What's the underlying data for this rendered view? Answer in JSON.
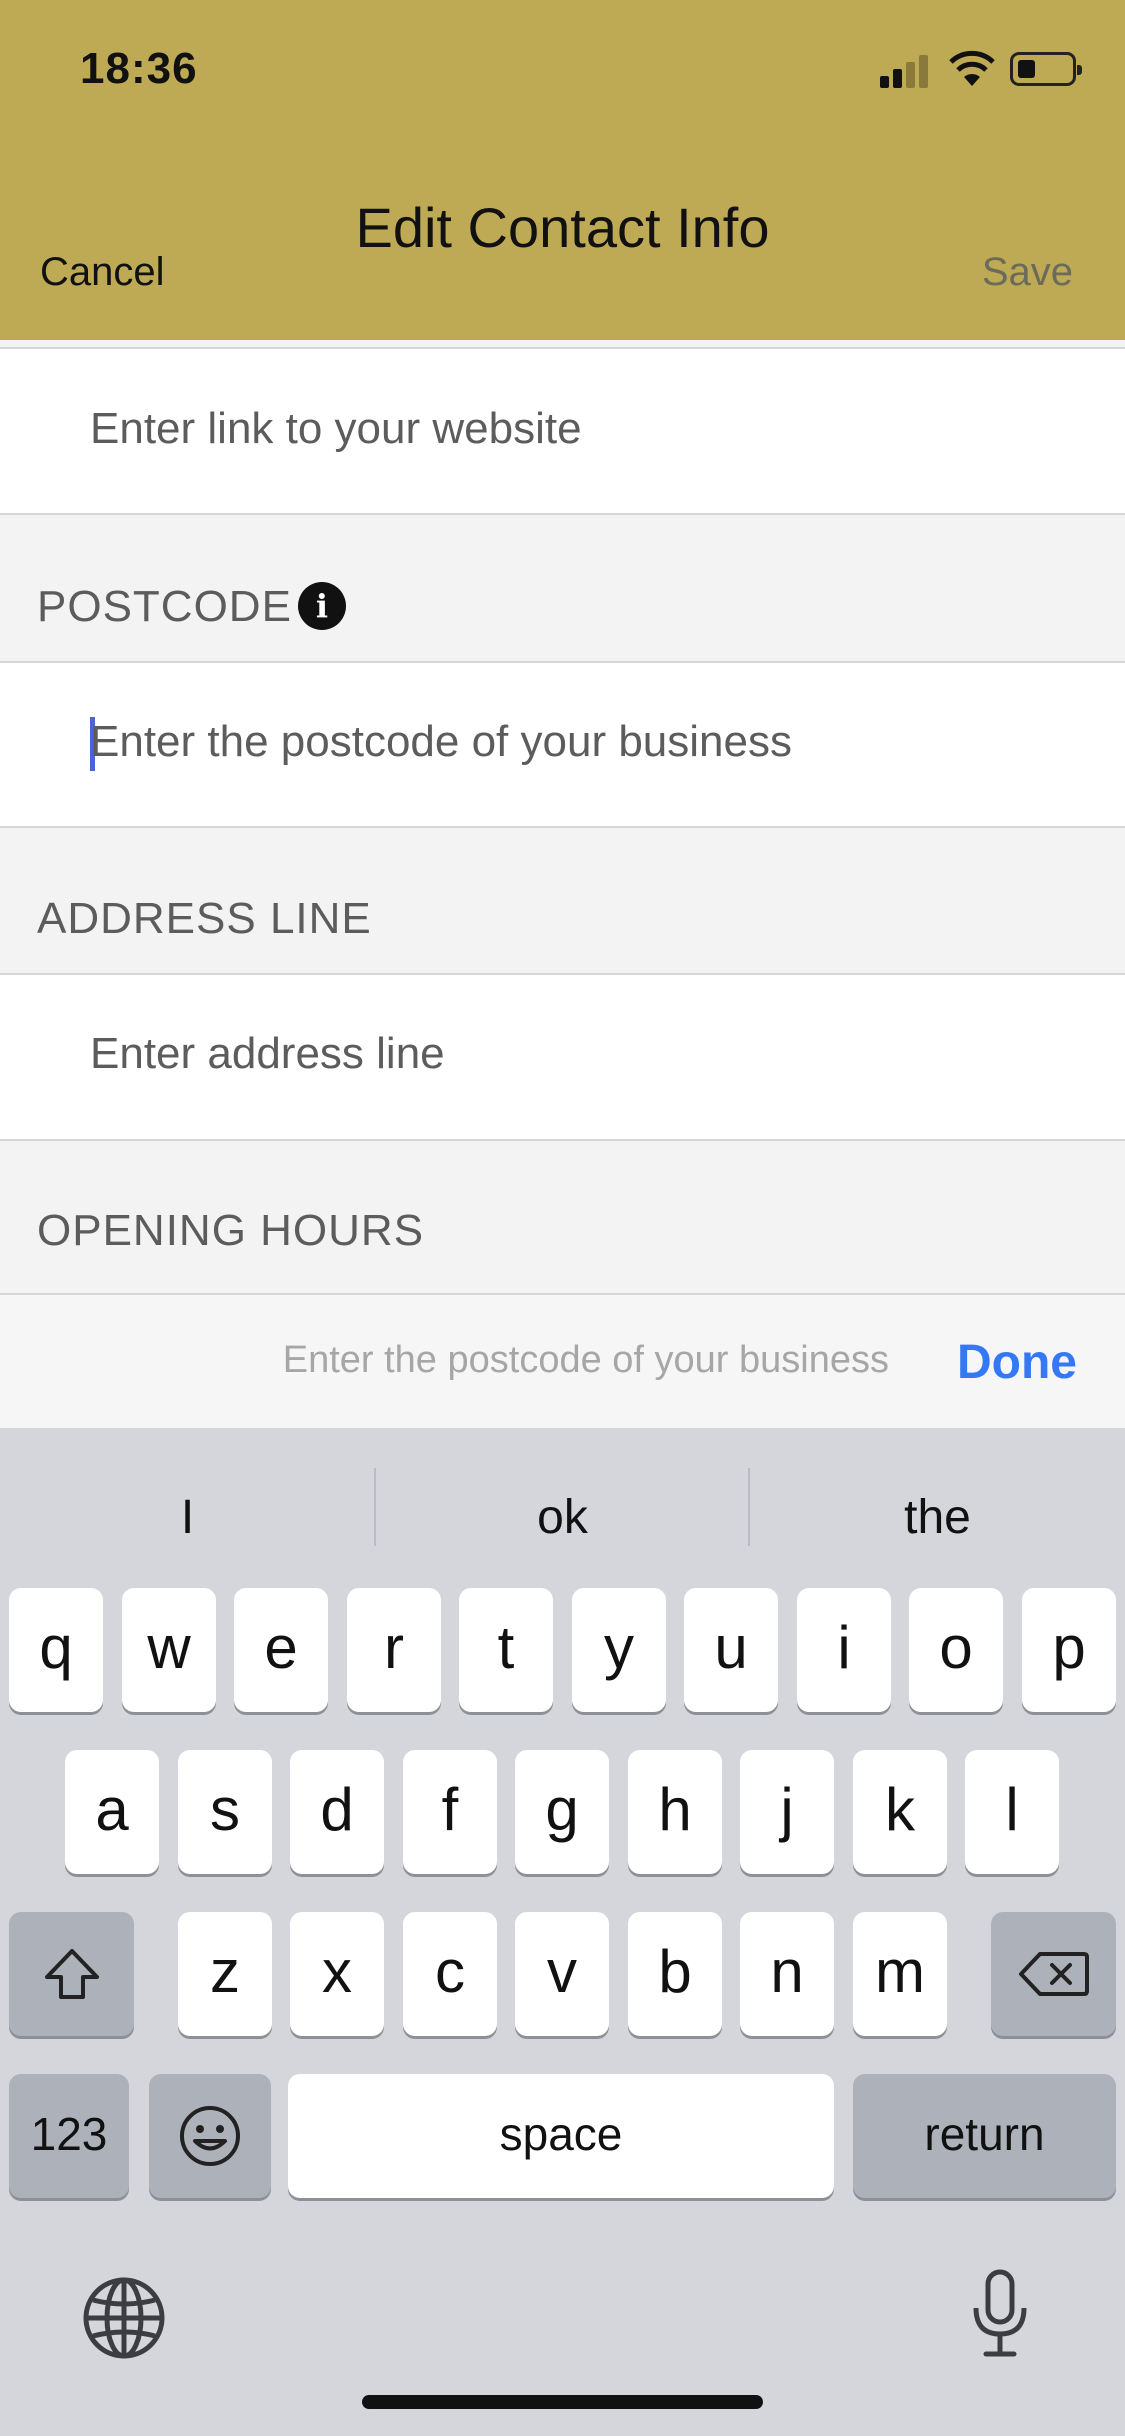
{
  "status_bar": {
    "time": "18:36"
  },
  "header": {
    "title": "Edit Contact Info",
    "cancel_label": "Cancel",
    "save_label": "Save",
    "background_color": "#bea954"
  },
  "form": {
    "website_placeholder": "Enter link to your website",
    "postcode": {
      "label": "POSTCODE",
      "placeholder": "Enter the postcode of your business"
    },
    "address": {
      "label": "ADDRESS LINE",
      "placeholder": "Enter address line"
    },
    "opening_hours": {
      "label": "OPENING HOURS"
    }
  },
  "accessory_bar": {
    "hint": "Enter the postcode of your business",
    "done_label": "Done",
    "done_color": "#3478f6"
  },
  "keyboard": {
    "suggestions": [
      "I",
      "ok",
      "the"
    ],
    "row1": [
      "q",
      "w",
      "e",
      "r",
      "t",
      "y",
      "u",
      "i",
      "o",
      "p"
    ],
    "row2": [
      "a",
      "s",
      "d",
      "f",
      "g",
      "h",
      "j",
      "k",
      "l"
    ],
    "row3": [
      "z",
      "x",
      "c",
      "v",
      "b",
      "n",
      "m"
    ],
    "numbers_label": "123",
    "space_label": "space",
    "return_label": "return",
    "icons": [
      "shift-icon",
      "backspace-icon",
      "emoji-icon",
      "globe-icon",
      "microphone-icon"
    ]
  }
}
